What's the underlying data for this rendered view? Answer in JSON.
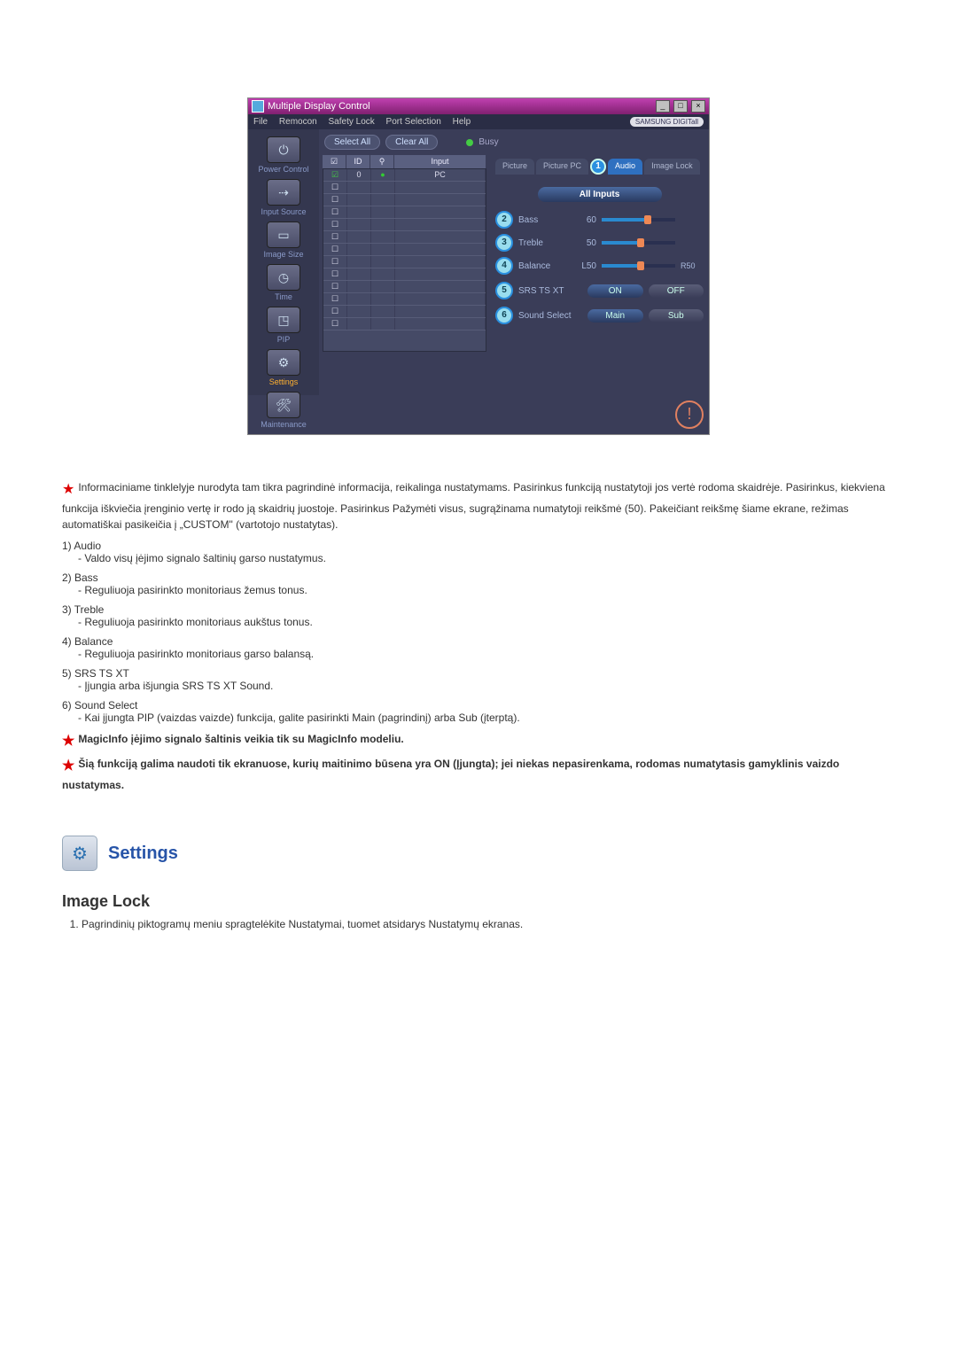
{
  "window": {
    "title": "Multiple Display Control",
    "brand": "SAMSUNG DIGITall"
  },
  "menu": {
    "file": "File",
    "remocon": "Remocon",
    "safety": "Safety Lock",
    "port": "Port Selection",
    "help": "Help"
  },
  "sidebar": {
    "power": "Power Control",
    "input": "Input Source",
    "size": "Image Size",
    "time": "Time",
    "pip": "PIP",
    "settings": "Settings",
    "maint": "Maintenance"
  },
  "toolbar": {
    "select_all": "Select All",
    "clear_all": "Clear All",
    "busy": "Busy"
  },
  "grid": {
    "head_id": "ID",
    "head_input": "Input",
    "rows": [
      {
        "checked": true,
        "id": "0",
        "status": "●",
        "input": "PC"
      },
      {
        "checked": false,
        "id": "",
        "status": "",
        "input": ""
      },
      {
        "checked": false,
        "id": "",
        "status": "",
        "input": ""
      },
      {
        "checked": false,
        "id": "",
        "status": "",
        "input": ""
      },
      {
        "checked": false,
        "id": "",
        "status": "",
        "input": ""
      },
      {
        "checked": false,
        "id": "",
        "status": "",
        "input": ""
      },
      {
        "checked": false,
        "id": "",
        "status": "",
        "input": ""
      },
      {
        "checked": false,
        "id": "",
        "status": "",
        "input": ""
      },
      {
        "checked": false,
        "id": "",
        "status": "",
        "input": ""
      },
      {
        "checked": false,
        "id": "",
        "status": "",
        "input": ""
      },
      {
        "checked": false,
        "id": "",
        "status": "",
        "input": ""
      },
      {
        "checked": false,
        "id": "",
        "status": "",
        "input": ""
      },
      {
        "checked": false,
        "id": "",
        "status": "",
        "input": ""
      }
    ]
  },
  "tabs": {
    "picture": "Picture",
    "picture_pc": "Picture PC",
    "audio": "Audio",
    "image_lock": "Image Lock"
  },
  "panel": {
    "all_inputs": "All Inputs",
    "bass": {
      "label": "Bass",
      "value": "60",
      "pct": 60
    },
    "treble": {
      "label": "Treble",
      "value": "50",
      "pct": 50
    },
    "balance": {
      "label": "Balance",
      "left": "L50",
      "right": "R50",
      "pct": 50
    },
    "srs": {
      "label": "SRS TS XT",
      "on": "ON",
      "off": "OFF"
    },
    "sound_select": {
      "label": "Sound Select",
      "main": "Main",
      "sub": "Sub"
    }
  },
  "desc": {
    "intro": "Informaciniame tinklelyje nurodyta tam tikra pagrindinė informacija, reikalinga nustatymams. Pasirinkus funkciją nustatytoji jos vertė rodoma skaidrėje. Pasirinkus, kiekviena funkcija iškviečia įrenginio vertę ir rodo ją skaidrių juostoje. Pasirinkus Pažymėti visus, sugrąžinama numatytoji reikšmė (50). Pakeičiant reikšmę šiame ekrane, režimas automatiškai pasikeičia į „CUSTOM\" (vartotojo nustatytas).",
    "i1_t": "1) Audio",
    "i1_d": "- Valdo visų įėjimo signalo šaltinių garso nustatymus.",
    "i2_t": "2) Bass",
    "i2_d": "- Reguliuoja pasirinkto monitoriaus žemus tonus.",
    "i3_t": "3) Treble",
    "i3_d": "- Reguliuoja pasirinkto monitoriaus aukštus tonus.",
    "i4_t": "4) Balance",
    "i4_d": "- Reguliuoja pasirinkto monitoriaus garso balansą.",
    "i5_t": "5) SRS TS XT",
    "i5_d": "- Įjungia arba išjungia SRS TS XT Sound.",
    "i6_t": "6) Sound Select",
    "i6_d": "- Kai įjungta PIP (vaizdas vaizde) funkcija, galite pasirinkti Main (pagrindinį) arba Sub (įterptą).",
    "note1": "MagicInfo įėjimo signalo šaltinis veikia tik su MagicInfo modeliu.",
    "note2": "Šią funkciją galima naudoti tik ekranuose, kurių maitinimo būsena yra ON (Įjungta); jei niekas nepasirenkama, rodomas numatytasis gamyklinis vaizdo nustatymas."
  },
  "settings_heading": "Settings",
  "subheading": "Image Lock",
  "numlist_1": "Pagrindinių piktogramų meniu spragtelėkite Nustatymai, tuomet atsidarys Nustatymų ekranas."
}
